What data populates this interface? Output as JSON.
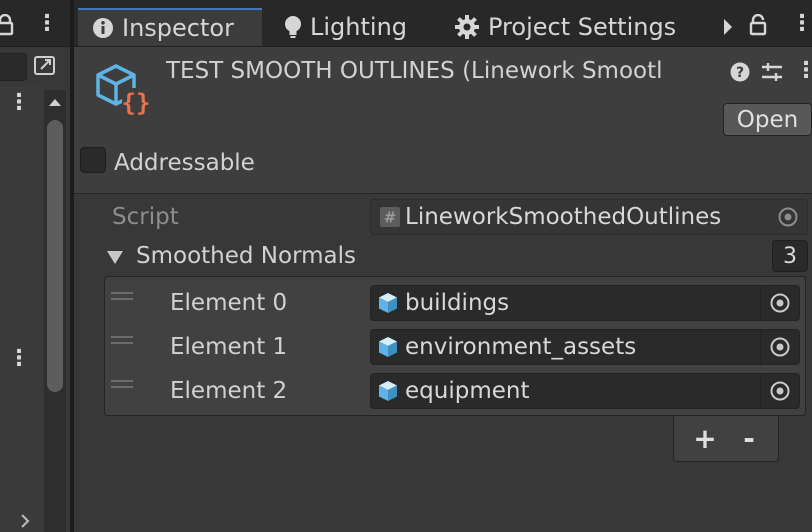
{
  "tabs": [
    {
      "label": "Inspector",
      "icon": "info-icon"
    },
    {
      "label": "Lighting",
      "icon": "lightbulb-icon"
    },
    {
      "label": "Project Settings",
      "icon": "gear-icon"
    }
  ],
  "header": {
    "title": "TEST SMOOTH OUTLINES (Linework Smootl",
    "open_label": "Open",
    "addressable_label": "Addressable",
    "addressable_checked": false
  },
  "script_field": {
    "label": "Script",
    "value": "LineworkSmoothedOutlines"
  },
  "list": {
    "label": "Smoothed Normals",
    "count": "3",
    "elements": [
      {
        "label": "Element 0",
        "value": "buildings"
      },
      {
        "label": "Element 1",
        "value": "environment_assets"
      },
      {
        "label": "Element 2",
        "value": "equipment"
      }
    ],
    "add_label": "+",
    "remove_label": "-"
  },
  "colors": {
    "accent": "#3a79bb",
    "asset_icon_blue": "#5eb4e4",
    "asset_icon_orange": "#e8734a"
  }
}
